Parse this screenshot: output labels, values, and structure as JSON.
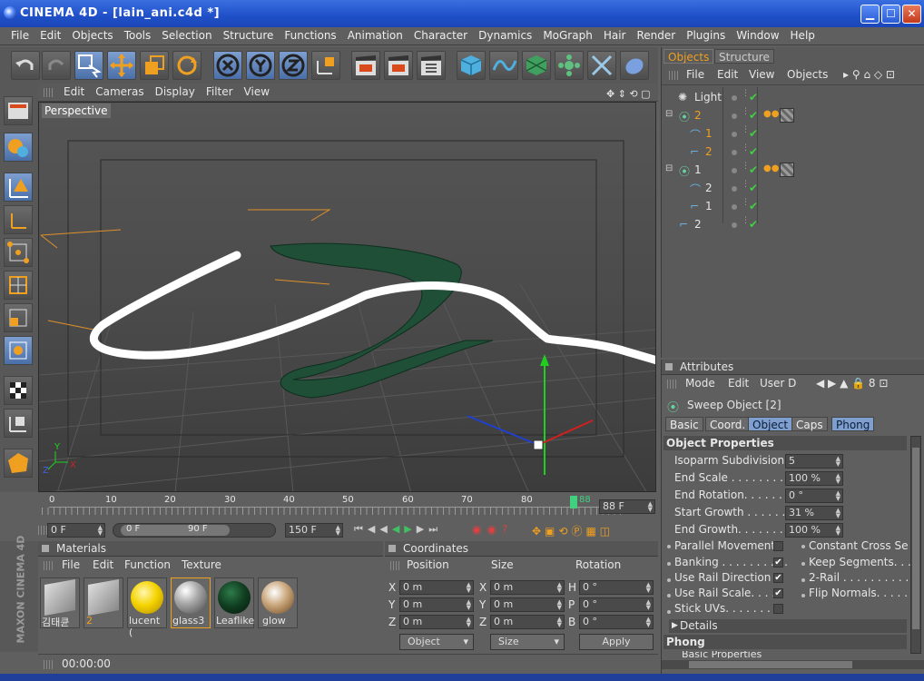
{
  "window": {
    "title": "CINEMA 4D - [lain_ani.c4d *]"
  },
  "menu": [
    "File",
    "Edit",
    "Objects",
    "Tools",
    "Selection",
    "Structure",
    "Functions",
    "Animation",
    "Character",
    "Dynamics",
    "MoGraph",
    "Hair",
    "Render",
    "Plugins",
    "Window",
    "Help"
  ],
  "viewport": {
    "menu": [
      "Edit",
      "Cameras",
      "Display",
      "Filter",
      "View"
    ],
    "label": "Perspective"
  },
  "timeline": {
    "ticks": [
      "0",
      "10",
      "20",
      "30",
      "40",
      "50",
      "60",
      "70",
      "80",
      "88"
    ],
    "current_frame": "88 F",
    "start": "0 F",
    "range_start": "0 F",
    "range_end": "90 F",
    "end": "150 F"
  },
  "objects_panel": {
    "tabs": [
      "Objects",
      "Structure"
    ],
    "menu": [
      "File",
      "Edit",
      "View",
      "Objects"
    ],
    "items": [
      {
        "name": "Light",
        "depth": 0
      },
      {
        "name": "2",
        "depth": 0,
        "highlight": true
      },
      {
        "name": "1",
        "depth": 1,
        "highlight": true
      },
      {
        "name": "2",
        "depth": 1,
        "highlight": true
      },
      {
        "name": "1",
        "depth": 0
      },
      {
        "name": "2",
        "depth": 1
      },
      {
        "name": "1",
        "depth": 1
      },
      {
        "name": "2",
        "depth": 0
      }
    ]
  },
  "attributes": {
    "header": "Attributes",
    "menu": [
      "Mode",
      "Edit",
      "User D"
    ],
    "object_title": "Sweep Object [2]",
    "tabs": [
      "Basic",
      "Coord.",
      "Object",
      "Caps",
      "Phong"
    ],
    "section": "Object Properties",
    "props": [
      {
        "label": "Isoparm Subdivision",
        "value": "5"
      },
      {
        "label": "End Scale . . . . . . . .",
        "value": "100 %"
      },
      {
        "label": "End Rotation. . . . . .",
        "value": "0 °"
      },
      {
        "label": "Start Growth . . . . . .",
        "value": "31 %"
      },
      {
        "label": "End Growth. . . . . . .",
        "value": "100 %"
      }
    ],
    "checks_left": [
      {
        "label": "Parallel Movement",
        "checked": false
      },
      {
        "label": "Banking . . . . . . . . . .",
        "checked": true
      },
      {
        "label": "Use Rail Direction",
        "checked": true
      },
      {
        "label": "Use Rail Scale. . . . .",
        "checked": true
      },
      {
        "label": "Stick UVs. . . . . . . .",
        "checked": false
      }
    ],
    "checks_right": [
      {
        "label": "Constant Cross Se"
      },
      {
        "label": "Keep Segments. . ."
      },
      {
        "label": "2-Rail . . . . . . . . . ."
      },
      {
        "label": "Flip Normals. . . . . ."
      }
    ],
    "details": "Details",
    "phong": "Phong",
    "basic_props": "Basic Properties"
  },
  "materials": {
    "header": "Materials",
    "menu": [
      "File",
      "Edit",
      "Function",
      "Texture"
    ],
    "items": [
      {
        "name": "김태큔"
      },
      {
        "name": "2"
      },
      {
        "name": "lucent (",
        "color": "#f5d400"
      },
      {
        "name": "glass3",
        "color": "#c8c8c8"
      },
      {
        "name": "Leaflike",
        "color": "#0f3d1f"
      },
      {
        "name": "glow",
        "color": "#c9a57a"
      }
    ]
  },
  "coordinates": {
    "header": "Coordinates",
    "cols": [
      "Position",
      "Size",
      "Rotation"
    ],
    "rows": [
      {
        "a": "X",
        "pos": "0 m",
        "b": "X",
        "size": "0 m",
        "c": "H",
        "rot": "0 °"
      },
      {
        "a": "Y",
        "pos": "0 m",
        "b": "Y",
        "size": "0 m",
        "c": "P",
        "rot": "0 °"
      },
      {
        "a": "Z",
        "pos": "0 m",
        "b": "Z",
        "size": "0 m",
        "c": "B",
        "rot": "0 °"
      }
    ],
    "mode_object": "Object",
    "mode_size": "Size",
    "apply": "Apply"
  },
  "statusbar": {
    "time": "00:00:00"
  },
  "brand": "MAXON CINEMA 4D"
}
